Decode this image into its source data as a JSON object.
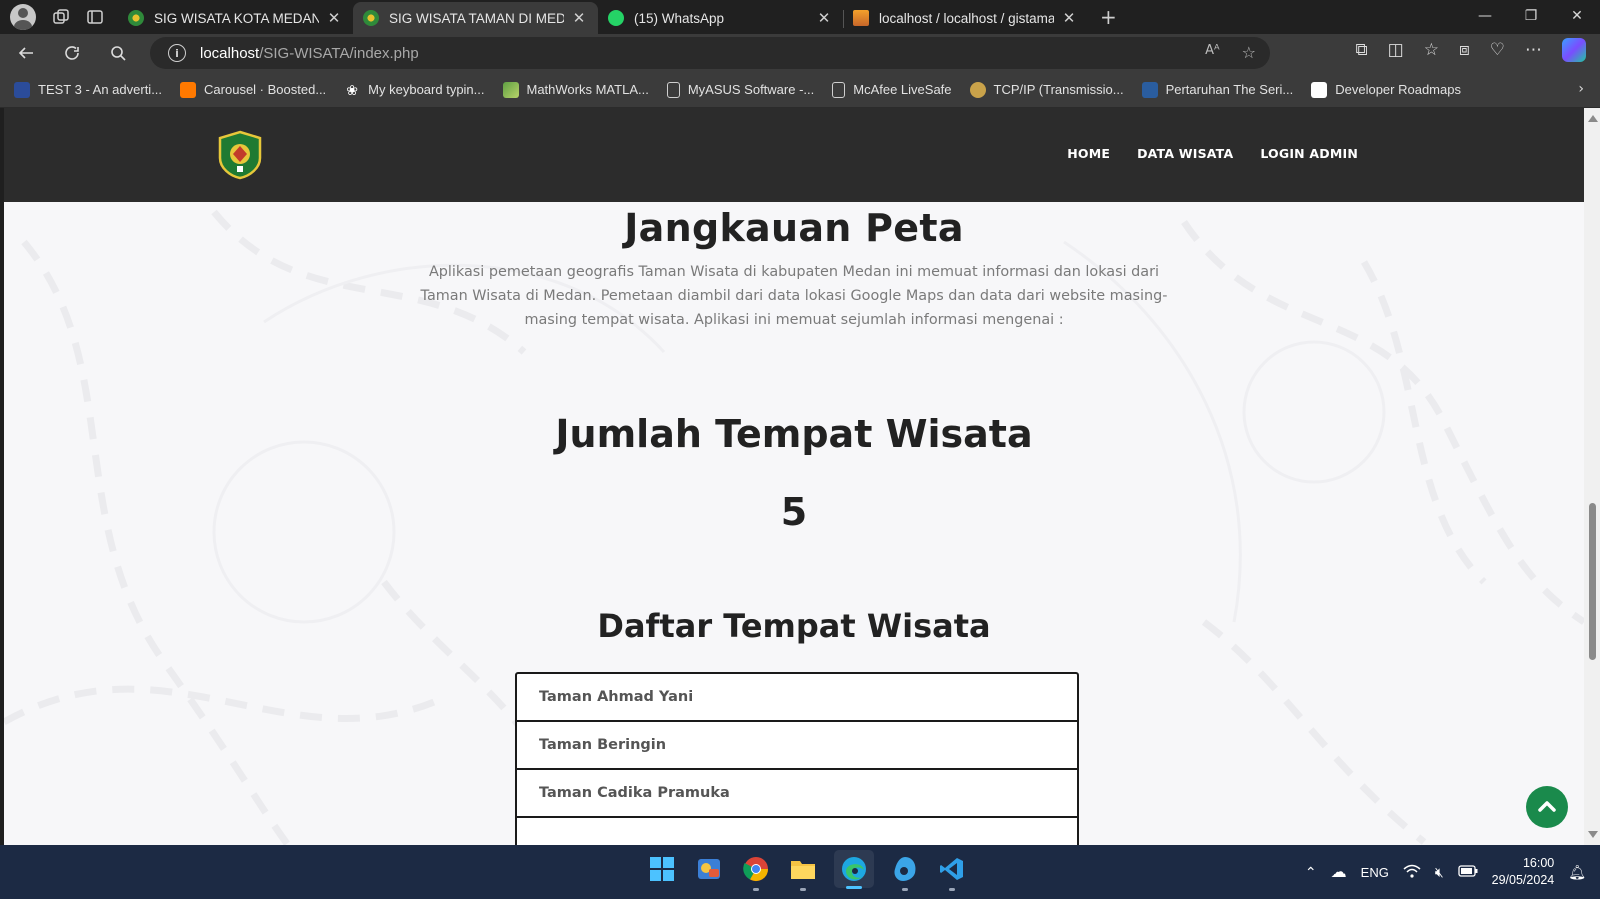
{
  "browser": {
    "tabs": [
      {
        "title": "SIG WISATA KOTA MEDAN - Dasl",
        "active": false,
        "favicon": "medan-seal-icon"
      },
      {
        "title": "SIG WISATA TAMAN DI MEDAN",
        "active": true,
        "favicon": "medan-seal-icon"
      },
      {
        "title": "(15) WhatsApp",
        "active": false,
        "favicon": "whatsapp-icon"
      },
      {
        "title": "localhost / localhost / gistaman |",
        "active": false,
        "favicon": "phpmyadmin-icon"
      }
    ],
    "url": {
      "host": "localhost",
      "path": "/SIG-WISATA/index.php"
    },
    "favorites": [
      {
        "label": "TEST 3 - An adverti...",
        "icon": "document-e-icon",
        "color": "#2b4c9a"
      },
      {
        "label": "Carousel · Boosted...",
        "icon": "orange-square-icon",
        "color": "#ff7900"
      },
      {
        "label": "My keyboard typin...",
        "icon": "paw-icon",
        "color": "#ffffff"
      },
      {
        "label": "MathWorks MATLA...",
        "icon": "matlab-icon",
        "color": "#5fa043"
      },
      {
        "label": "MyASUS Software -...",
        "icon": "page-icon",
        "color": "#cfcfcf"
      },
      {
        "label": "McAfee LiveSafe",
        "icon": "page-icon",
        "color": "#cfcfcf"
      },
      {
        "label": "TCP/IP (Transmissio...",
        "icon": "globe-icon",
        "color": "#c9a24a"
      },
      {
        "label": "Pertaruhan The Seri...",
        "icon": "bookmark-blue-icon",
        "color": "#2a5d9f"
      },
      {
        "label": "Developer Roadmaps",
        "icon": "roadmap-icon",
        "color": "#ffffff"
      }
    ]
  },
  "site": {
    "nav": [
      {
        "label": "HOME"
      },
      {
        "label": "DATA WISATA"
      },
      {
        "label": "LOGIN ADMIN"
      }
    ],
    "jangkauan": {
      "title": "Jangkauan Peta",
      "description": "Aplikasi pemetaan geografis Taman Wisata di kabupaten Medan ini memuat informasi dan lokasi dari Taman Wisata di Medan. Pemetaan diambil dari data lokasi Google Maps dan data dari website masing-masing tempat wisata. Aplikasi ini memuat sejumlah informasi mengenai :"
    },
    "jumlah": {
      "title": "Jumlah Tempat Wisata",
      "count": "5"
    },
    "daftar": {
      "title": "Daftar Tempat Wisata",
      "items": [
        {
          "name": "Taman Ahmad Yani"
        },
        {
          "name": "Taman Beringin"
        },
        {
          "name": "Taman Cadika Pramuka"
        },
        {
          "name": ""
        }
      ]
    },
    "accent_color": "#1a8a4c",
    "header_color": "#2c2c2c"
  },
  "taskbar": {
    "apps": [
      "windows-start-icon",
      "weather-app-icon",
      "chrome-icon",
      "file-explorer-icon",
      "edge-icon",
      "edge-canary-icon",
      "vscode-icon"
    ],
    "language": "ENG",
    "time": "16:00",
    "date": "29/05/2024"
  }
}
